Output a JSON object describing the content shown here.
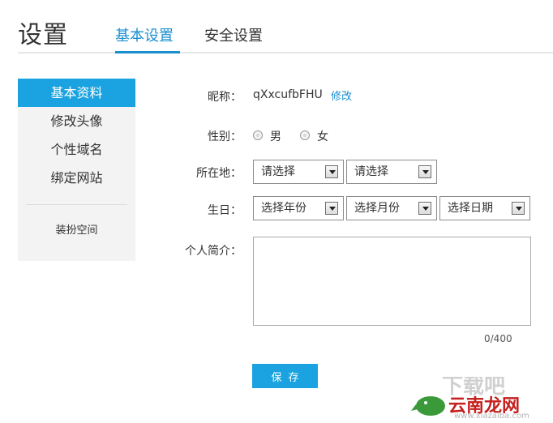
{
  "header": {
    "title": "设置",
    "tabs": [
      {
        "label": "基本设置",
        "active": true
      },
      {
        "label": "安全设置",
        "active": false
      }
    ],
    "accent_color": "#1a8fd0"
  },
  "sidebar": {
    "items": [
      {
        "label": "基本资料",
        "active": true
      },
      {
        "label": "修改头像",
        "active": false
      },
      {
        "label": "个性域名",
        "active": false
      },
      {
        "label": "绑定网站",
        "active": false
      }
    ],
    "extra_item": "装扮空间",
    "active_color": "#1aa3e0"
  },
  "form": {
    "nickname": {
      "label": "昵称：",
      "value": "qXxcufbFHU",
      "edit_label": "修改"
    },
    "gender": {
      "label": "性别：",
      "options": [
        "男",
        "女"
      ]
    },
    "location": {
      "label": "所在地：",
      "selects": [
        "请选择",
        "请选择"
      ]
    },
    "birthday": {
      "label": "生日：",
      "selects": [
        "选择年份",
        "选择月份",
        "选择日期"
      ]
    },
    "bio": {
      "label": "个人简介：",
      "value": "",
      "counter": "0/400"
    },
    "save_label": "保存"
  },
  "watermark": {
    "text": "云南龙网",
    "url": "www.xiazaiba.com"
  }
}
